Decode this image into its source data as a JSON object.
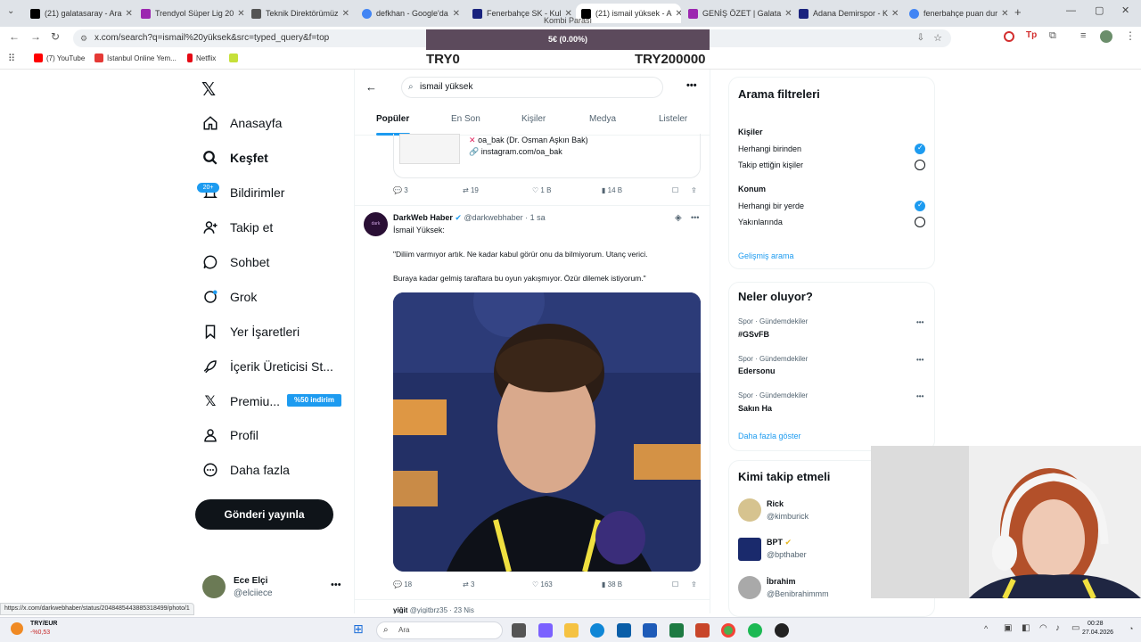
{
  "browser": {
    "tabs": [
      {
        "label": "(21) galatasaray - Ara",
        "color": "#000000"
      },
      {
        "label": "Trendyol Süper Lig 20",
        "color": "#9c27b0"
      },
      {
        "label": "Teknik Direktörümüz",
        "color": "#555555"
      },
      {
        "label": "defkhan - Google'da",
        "color": "#4285f4"
      },
      {
        "label": "Fenerbahçe SK - Kul",
        "color": "#1a237e"
      },
      {
        "label": "(21) ismail yüksek - A",
        "color": "#000000"
      },
      {
        "label": "GENİŞ ÖZET | Galata",
        "color": "#9c27b0"
      },
      {
        "label": "Adana Demirspor - K",
        "color": "#1a237e"
      },
      {
        "label": "fenerbahçe puan dur",
        "color": "#4285f4"
      }
    ],
    "url": "x.com/search?q=ismail%20yüksek&src=typed_query&f=top",
    "bookmarks": [
      {
        "label": "(7) YouTube",
        "color": "#ff0000"
      },
      {
        "label": "İstanbul Online Yem...",
        "color": "#e53935"
      },
      {
        "label": "Netflix",
        "color": "#e50914"
      },
      {
        "label": "",
        "color": "#c6e03a"
      }
    ],
    "status_url": "https://x.com/darkwebhaber/status/2048485443885318499/photo/1"
  },
  "overlay": {
    "title": "Kombi Parası",
    "bar_text": "5€ (0.00%)",
    "min_label": "TRY0",
    "max_label": "TRY200000"
  },
  "nav": {
    "items": [
      {
        "label": "Anasayfa",
        "icon": "home-icon"
      },
      {
        "label": "Keşfet",
        "icon": "search-icon"
      },
      {
        "label": "Bildirimler",
        "icon": "bell-icon"
      },
      {
        "label": "Takip et",
        "icon": "person-add-icon"
      },
      {
        "label": "Sohbet",
        "icon": "chat-icon"
      },
      {
        "label": "Grok",
        "icon": "grok-icon"
      },
      {
        "label": "Yer İşaretleri",
        "icon": "bookmark-icon"
      },
      {
        "label": "İçerik Üreticisi St...",
        "icon": "rocket-icon"
      },
      {
        "label": "Premiu...",
        "icon": "x-logo-icon"
      },
      {
        "label": "Profil",
        "icon": "profile-icon"
      },
      {
        "label": "Daha fazla",
        "icon": "more-circle-icon"
      }
    ],
    "notif_badge": "20+",
    "premium_badge": "%50 indirim",
    "post_button": "Gönderi yayınla",
    "account": {
      "name": "Ece Elçi",
      "handle": "@elciiece"
    }
  },
  "search": {
    "query": "ismail yüksek",
    "tabs": [
      "Popüler",
      "En Son",
      "Kişiler",
      "Medya",
      "Listeler"
    ]
  },
  "prev_post": {
    "embed_line1": "oa_bak (Dr. Osman Aşkın Bak)",
    "embed_line2": "instagram.com/oa_bak",
    "replies": "3",
    "reposts": "19",
    "likes": "1 B",
    "views": "14 B"
  },
  "post": {
    "author": "DarkWeb Haber",
    "handle": "@darkwebhaber",
    "time": "· 1 sa",
    "line1": "İsmail Yüksek:",
    "line2": "\"Diliim varmıyor artık. Ne kadar kabul görür onu da bilmiyorum. Utanç verici.",
    "line3": "Buraya kadar gelmiş taraftara bu oyun yakışmıyor. Özür dilemek istiyorum.\"",
    "replies": "18",
    "reposts": "3",
    "likes": "163",
    "views": "38 B"
  },
  "next_post": {
    "author": "yiğit",
    "handle": "@yigitbrz35 · 23 Nis"
  },
  "filters": {
    "title": "Arama filtreleri",
    "people_label": "Kişiler",
    "people_opts": [
      "Herhangi birinden",
      "Takip ettiğin kişiler"
    ],
    "location_label": "Konum",
    "location_opts": [
      "Herhangi bir yerde",
      "Yakınlarında"
    ],
    "advanced": "Gelişmiş arama"
  },
  "trends": {
    "title": "Neler oluyor?",
    "items": [
      {
        "meta": "Spor · Gündemdekiler",
        "name": "#GSvFB"
      },
      {
        "meta": "Spor · Gündemdekiler",
        "name": "Edersonu"
      },
      {
        "meta": "Spor · Gündemdekiler",
        "name": "Sakın Ha"
      }
    ],
    "show_more": "Daha fazla göster"
  },
  "follow": {
    "title": "Kimi takip etmeli",
    "items": [
      {
        "name": "Rick",
        "handle": "@kimburick"
      },
      {
        "name": "BPT",
        "handle": "@bpthaber"
      },
      {
        "name": "İbrahim",
        "handle": "@Benibrahimmm"
      }
    ]
  },
  "taskbar": {
    "weather_label": "TRY/EUR",
    "weather_value": "-%0,53",
    "search_placeholder": "Ara",
    "time": "00:28",
    "date": "27.04.2026"
  }
}
